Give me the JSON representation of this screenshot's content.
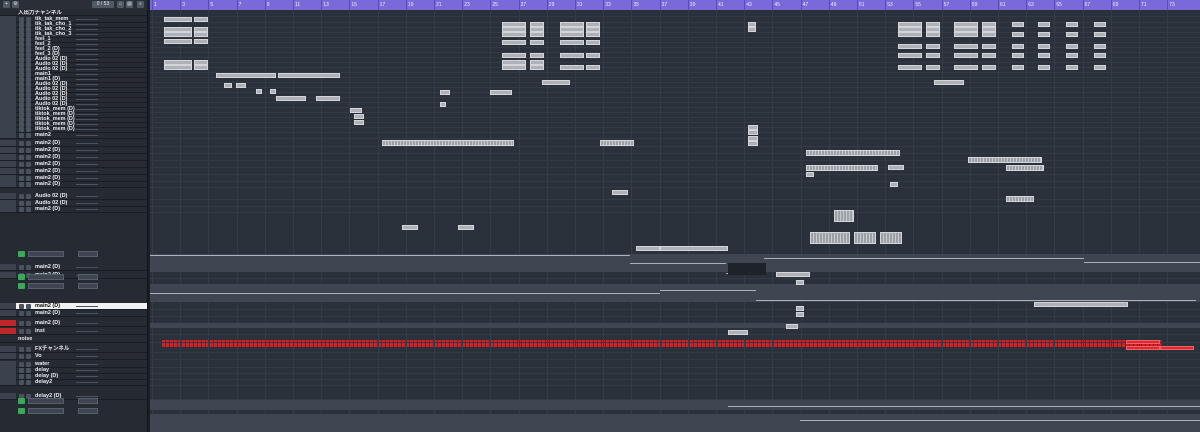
{
  "toolbar": {
    "counter": "0 / 53"
  },
  "ruler": {
    "ticks": [
      "1",
      "3",
      "5",
      "7",
      "9",
      "11",
      "13",
      "15",
      "17",
      "19",
      "21",
      "23",
      "25",
      "27",
      "29",
      "31",
      "33",
      "35",
      "37",
      "39",
      "41",
      "43",
      "45",
      "47",
      "49",
      "51",
      "53",
      "55",
      "57",
      "59",
      "61",
      "63",
      "65",
      "67",
      "69",
      "71",
      "73"
    ]
  },
  "tracks": [
    {
      "name": "入出力チャンネル"
    },
    {
      "name": "tik_tak_mem"
    },
    {
      "name": "tik_tak_cho_1"
    },
    {
      "name": "tik_tak_cho_2"
    },
    {
      "name": "tik_tak_cho_3"
    },
    {
      "name": "feel_1"
    },
    {
      "name": "feel_2"
    },
    {
      "name": "feel_2 (D)"
    },
    {
      "name": "feel_3 (D)"
    },
    {
      "name": "Audio 02 (D)"
    },
    {
      "name": "Audio 02 (D)"
    },
    {
      "name": "Audio 02 (D)"
    },
    {
      "name": "main1"
    },
    {
      "name": "main1 (D)"
    },
    {
      "name": "Audio 02 (D)"
    },
    {
      "name": "Audio 02 (D)"
    },
    {
      "name": "Audio 02 (D)"
    },
    {
      "name": "Audio 02 (D)"
    },
    {
      "name": "Audio 02 (D)"
    },
    {
      "name": "tiktok_mem (D)"
    },
    {
      "name": "tiktok_mem (D)"
    },
    {
      "name": "tiktok_mem (D)"
    },
    {
      "name": "tiktok_mem (D)"
    },
    {
      "name": "tiktok_mem (D)"
    },
    {
      "name": "main2"
    },
    {
      "name": "main2 (D)"
    },
    {
      "name": "main2 (D)"
    },
    {
      "name": "main2 (D)"
    },
    {
      "name": "main2 (D)"
    },
    {
      "name": "main2 (D)"
    },
    {
      "name": "main2 (D)"
    },
    {
      "name": "main2 (D)"
    },
    {
      "name": "Audio 02 (D)"
    },
    {
      "name": "Audio 02 (D)"
    },
    {
      "name": "main2 (D)"
    },
    {
      "name": "main2 (D)"
    },
    {
      "name": "main2 (D)"
    },
    {
      "name": "main2 (D)"
    },
    {
      "name": "main2 (D)"
    },
    {
      "name": "main2 (D)"
    },
    {
      "name": "inst"
    },
    {
      "name": "noise"
    },
    {
      "name": "FXチャンネル"
    },
    {
      "name": "Vo"
    },
    {
      "name": "water"
    },
    {
      "name": "delay"
    },
    {
      "name": "delay (D)"
    },
    {
      "name": "delay2"
    },
    {
      "name": "delay2 (D)"
    }
  ],
  "colors": {
    "ruler": "#7a69d8",
    "clip": "#aeb2b8",
    "selected": "#f2f2f2",
    "red": "#d92b30",
    "green": "#3ba85a"
  }
}
